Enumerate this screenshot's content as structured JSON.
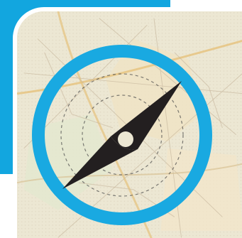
{
  "icon": {
    "name": "compass-icon",
    "description_name": "map-background"
  },
  "colors": {
    "accent": "#12a6df",
    "ring": "#19a9e1",
    "needle": "#231f20",
    "map_base": "#ece7d3",
    "map_lines": "#c9b9a0",
    "map_roads": "#e6c27c",
    "frame": "#ffffff"
  }
}
